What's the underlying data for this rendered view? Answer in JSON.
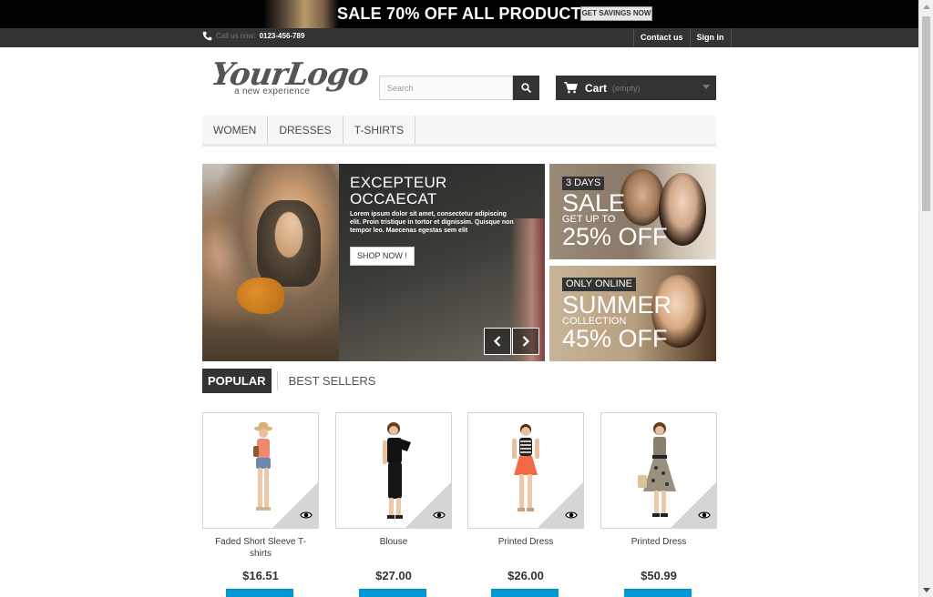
{
  "promo": {
    "text": "SALE 70% OFF ALL PRODUCTS",
    "button_label": "GET SAVINGS NOW"
  },
  "header": {
    "call_label": "Call us now:",
    "phone": "0123-456-789",
    "links": [
      {
        "label": "Contact us"
      },
      {
        "label": "Sign in"
      }
    ]
  },
  "logo": {
    "main": "YourLogo",
    "tagline": "a new experience"
  },
  "search": {
    "placeholder": "Search",
    "value": "",
    "icon": "search-icon"
  },
  "cart": {
    "label": "Cart",
    "status": "(empty)",
    "icon": "cart-icon"
  },
  "menu": {
    "items": [
      {
        "label": "Women"
      },
      {
        "label": "Dresses"
      },
      {
        "label": "T-shirts"
      }
    ]
  },
  "slider": {
    "title_line1": "EXCEPTEUR",
    "title_line2": "OCCAECAT",
    "text": "Lorem ipsum dolor sit amet, consectetur adipiscing elit. Proin tristique in tortor et dignissim. Quisque non tempor leo. Maecenas egestas sem elit",
    "button_label": "Shop now !"
  },
  "banners": [
    {
      "tag": "3 days",
      "big": "Sale",
      "small": "Get up to",
      "big2": "25% off"
    },
    {
      "tag": "Only online",
      "big": "Summer",
      "small": "Collection",
      "big2": "45% off"
    }
  ],
  "tabs": [
    {
      "label": "Popular",
      "active": true
    },
    {
      "label": "Best sellers",
      "active": false
    }
  ],
  "products": [
    {
      "name": "Faded Short Sleeve T-shirts",
      "price": "$16.51"
    },
    {
      "name": "Blouse",
      "price": "$27.00"
    },
    {
      "name": "Printed Dress",
      "price": "$26.00"
    },
    {
      "name": "Printed Dress",
      "price": "$50.99"
    }
  ],
  "colors": {
    "dark": "#333333",
    "accent_blue": "#0099d6",
    "border": "#d6d4d4"
  }
}
